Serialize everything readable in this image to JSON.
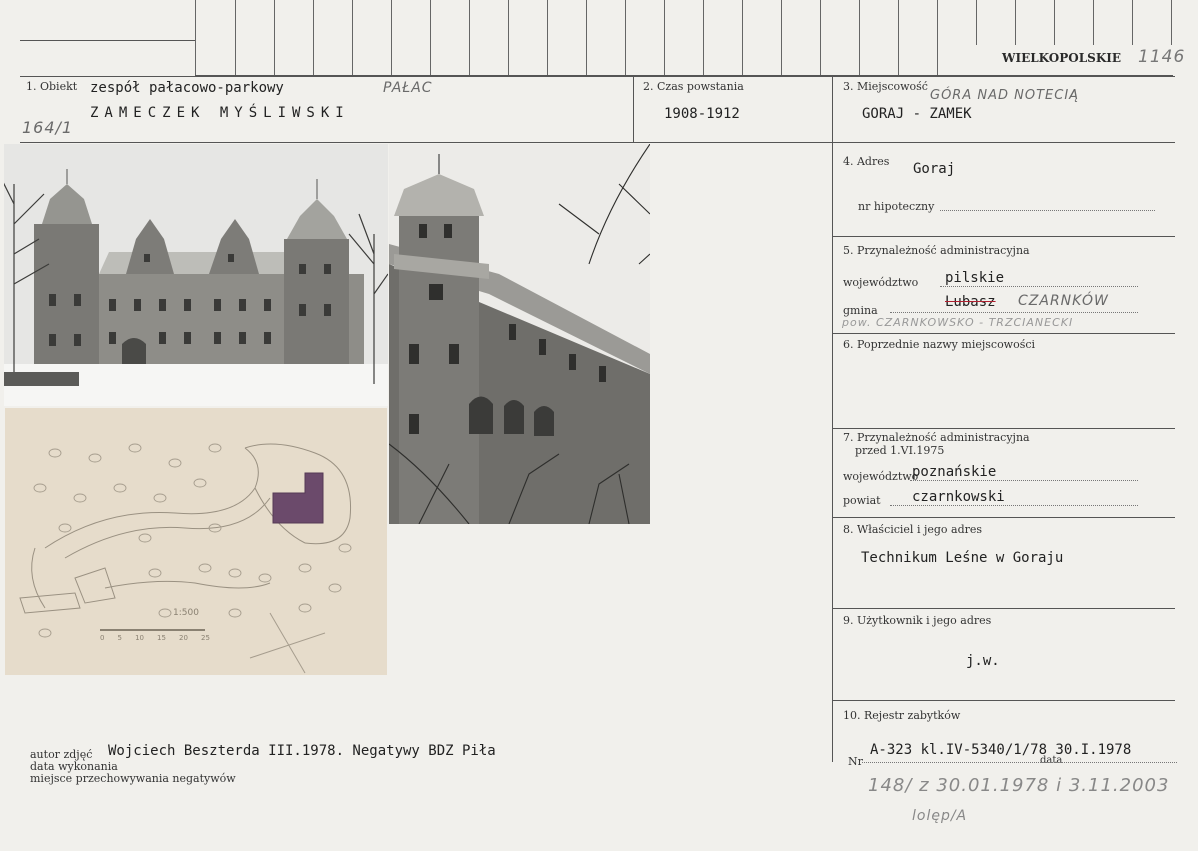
{
  "header": {
    "region": "WIELKOPOLSKIE",
    "card_no": "1146"
  },
  "obiekt": {
    "label": "1. Obiekt",
    "line1": "zespół pałacowo-parkowy",
    "line2": "ZAMECZEK MYŚLIWSKI",
    "annotation": "PAŁAC",
    "side_number": "164/1"
  },
  "czas": {
    "label": "2. Czas powstania",
    "value": "1908-1912"
  },
  "miejscowosc": {
    "label": "3. Miejscowość",
    "value": "GORAJ - ZAMEK",
    "annotation": "GÓRA NAD NOTECIĄ"
  },
  "adres": {
    "label": "4. Adres",
    "value": "Goraj",
    "hipoteczny_label": "nr hipoteczny"
  },
  "admin": {
    "label": "5. Przynależność administracyjna",
    "woj_label": "województwo",
    "woj_value": "pilskie",
    "gmina_label": "gmina",
    "gmina_value": "Lubasz",
    "gmina_handwritten": "CZARNKÓW",
    "pow_handwritten": "pow. CZARNKOWSKO - TRZCIANECKI"
  },
  "poprzednie": {
    "label": "6. Poprzednie nazwy miejscowości"
  },
  "admin_old": {
    "label_1": "7. Przynależność administracyjna",
    "label_2": "przed 1.VI.1975",
    "woj_label": "województwo",
    "woj_value": "poznańskie",
    "powiat_label": "powiat",
    "powiat_value": "czarnkowski"
  },
  "wlasciciel": {
    "label": "8. Właściciel i jego adres",
    "value": "Technikum Leśne w Goraju"
  },
  "uzytkownik": {
    "label": "9. Użytkownik i jego adres",
    "value": "j.w."
  },
  "rejestr": {
    "label": "10. Rejestr zabytków",
    "nr_label": "Nr",
    "data_label": "data",
    "value": "A-323 kl.IV-5340/1/78 30.I.1978",
    "handwritten_1": "148/ z 30.01.1978 i 3.11.2003",
    "handwritten_2": "lolęp/A"
  },
  "footer": {
    "autor_label": "autor zdjęć",
    "autor_value": "Wojciech Beszterda III.1978. Negatywy BDZ Piła",
    "data_label": "data wykonania",
    "miejsce_label": "miejsce przechowywania negatywów"
  },
  "map": {
    "scale": "1:500",
    "scale_ticks": [
      "0",
      "5",
      "10",
      "15",
      "20",
      "25"
    ]
  }
}
